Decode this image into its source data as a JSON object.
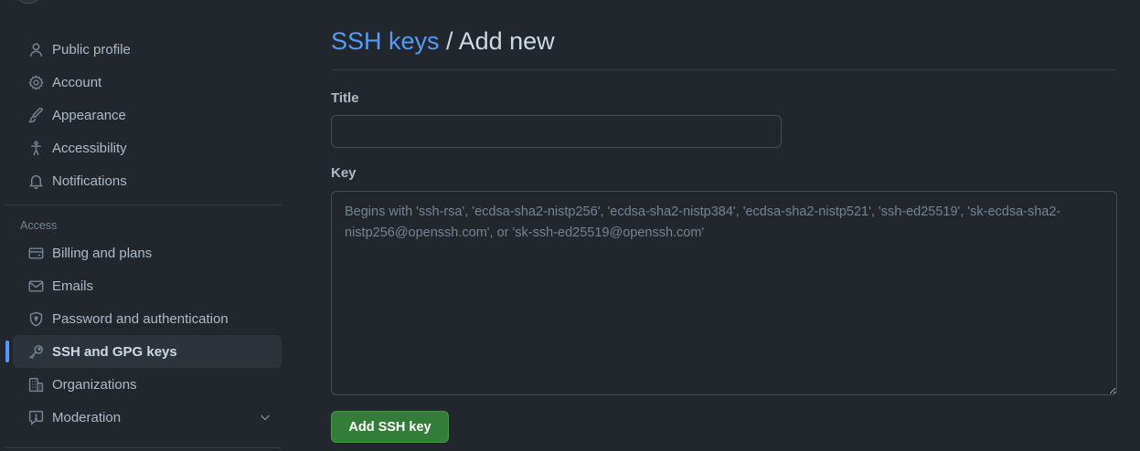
{
  "sidebar": {
    "items_top": [
      {
        "label": "Public profile",
        "icon": "person-icon"
      },
      {
        "label": "Account",
        "icon": "gear-icon"
      },
      {
        "label": "Appearance",
        "icon": "paintbrush-icon"
      },
      {
        "label": "Accessibility",
        "icon": "accessibility-icon"
      },
      {
        "label": "Notifications",
        "icon": "bell-icon"
      }
    ],
    "access_heading": "Access",
    "items_access": [
      {
        "label": "Billing and plans",
        "icon": "credit-card-icon"
      },
      {
        "label": "Emails",
        "icon": "mail-icon"
      },
      {
        "label": "Password and authentication",
        "icon": "shield-lock-icon"
      },
      {
        "label": "SSH and GPG keys",
        "icon": "key-icon",
        "active": true
      },
      {
        "label": "Organizations",
        "icon": "organization-icon"
      },
      {
        "label": "Moderation",
        "icon": "report-icon",
        "expandable": true
      }
    ]
  },
  "main": {
    "breadcrumb_link": "SSH keys",
    "breadcrumb_separator": " / ",
    "breadcrumb_current": "Add new",
    "title_label": "Title",
    "title_value": "",
    "key_label": "Key",
    "key_value": "",
    "key_placeholder": "Begins with 'ssh-rsa', 'ecdsa-sha2-nistp256', 'ecdsa-sha2-nistp384', 'ecdsa-sha2-nistp521', 'ssh-ed25519', 'sk-ecdsa-sha2-nistp256@openssh.com', or 'sk-ssh-ed25519@openssh.com'",
    "submit_label": "Add SSH key"
  },
  "colors": {
    "background": "#22272e",
    "accent_link": "#539bf5",
    "active_indicator": "#539bf5",
    "primary_button": "#347d39"
  }
}
